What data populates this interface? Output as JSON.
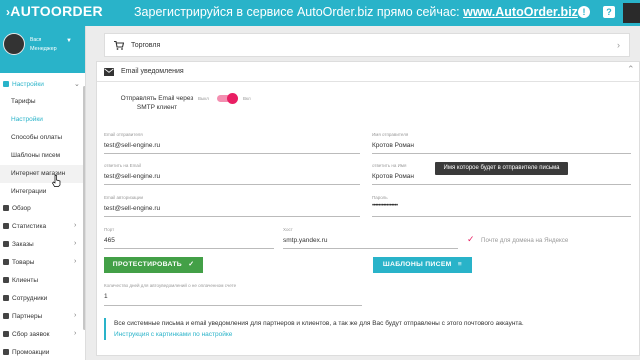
{
  "header": {
    "logo": "AUTOORDER",
    "promo_text": "Зарегистрируйся в сервисе AutoOrder.biz прямо сейчас:",
    "promo_link": "www.AutoOrder.biz",
    "alert_icon": "!",
    "help_icon": "?",
    "gift_icon": "gift-icon"
  },
  "profile": {
    "name": "Вася",
    "role": "Менеджер"
  },
  "sidebar": {
    "settings_label": "Настройки",
    "sub_items": [
      "Тарифы",
      "Настройки",
      "Способы оплаты",
      "Шаблоны писем",
      "Интернет магазин",
      "Интеграции"
    ],
    "items": [
      "Обзор",
      "Статистика",
      "Заказы",
      "Товары",
      "Клиенты",
      "Сотрудники",
      "Партнеры",
      "Сбор заявок",
      "Промоакции"
    ]
  },
  "trade_panel": {
    "title": "Торговля"
  },
  "email_panel": {
    "title": "Email уведомления",
    "smtp_toggle_label": "Отправлять Email через SMTP клиент",
    "toggle_off": "Выкл",
    "toggle_on": "Вкл",
    "sender_email_label": "Email отправителя",
    "sender_email_value": "test@sell-engine.ru",
    "sender_name_label": "Имя отправителя",
    "sender_name_value": "Кротов Роман",
    "reply_email_label": "ответить на Email",
    "reply_email_value": "test@sell-engine.ru",
    "reply_name_label": "ответить на Имя",
    "reply_name_value": "Кротов Роман",
    "auth_email_label": "Email авторизации",
    "auth_email_value": "test@sell-engine.ru",
    "password_label": "Пароль",
    "password_value": "••••••••••••••••",
    "port_label": "Порт",
    "port_value": "465",
    "host_label": "Хост",
    "host_value": "smtp.yandex.ru",
    "yandex_label": "Почте для домена на Яндексе",
    "test_button": "ПРОТЕСТИРОВАТЬ",
    "templates_button": "ШАБЛОНЫ ПИСЕМ",
    "days_label": "Количество дней для автоуведомлений о не оплаченном счете",
    "days_value": "1",
    "info_text": "Все системные письма и email уведомления для партнеров и клиентов, а так же для Вас будут отправлены с этого почтового аккаунта.",
    "info_link": "Инструкция с картинками по настройке"
  },
  "tooltip": "Имя которое будет в отправителе письма",
  "colors": {
    "accent": "#29b3c9",
    "toggle": "#e91e63",
    "green": "#43a047"
  }
}
